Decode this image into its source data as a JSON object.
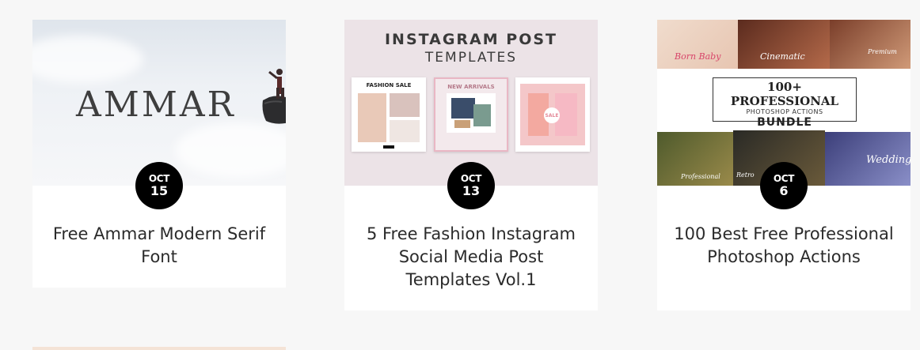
{
  "posts": [
    {
      "date": {
        "month": "OCT",
        "day": "15"
      },
      "title": "Free Ammar Modern Serif Font",
      "thumbnail": {
        "wordmark": "AMMAR"
      }
    },
    {
      "date": {
        "month": "OCT",
        "day": "13"
      },
      "title": "5 Free Fashion Instagram Social Media Post Templates Vol.1",
      "thumbnail": {
        "heading": "INSTAGRAM POST",
        "subheading": "TEMPLATES",
        "post_labels": [
          "FASHION SALE",
          "NEW ARRIVALS",
          "SALE"
        ]
      }
    },
    {
      "date": {
        "month": "OCT",
        "day": "6"
      },
      "title": "100 Best Free Professional Photoshop Actions",
      "thumbnail": {
        "line1": "100+ PROFESSIONAL",
        "line2": "PHOTOSHOP ACTIONS",
        "line3": "BUNDLE",
        "tile_labels": [
          "Born Baby",
          "Cinematic",
          "Premium",
          "Professional",
          "Retro",
          "Wedding"
        ]
      }
    }
  ],
  "colors": {
    "page_background": "#f7f7f7",
    "card_background": "#ffffff",
    "badge_background": "#000000",
    "title_text": "#2b2b2b"
  }
}
